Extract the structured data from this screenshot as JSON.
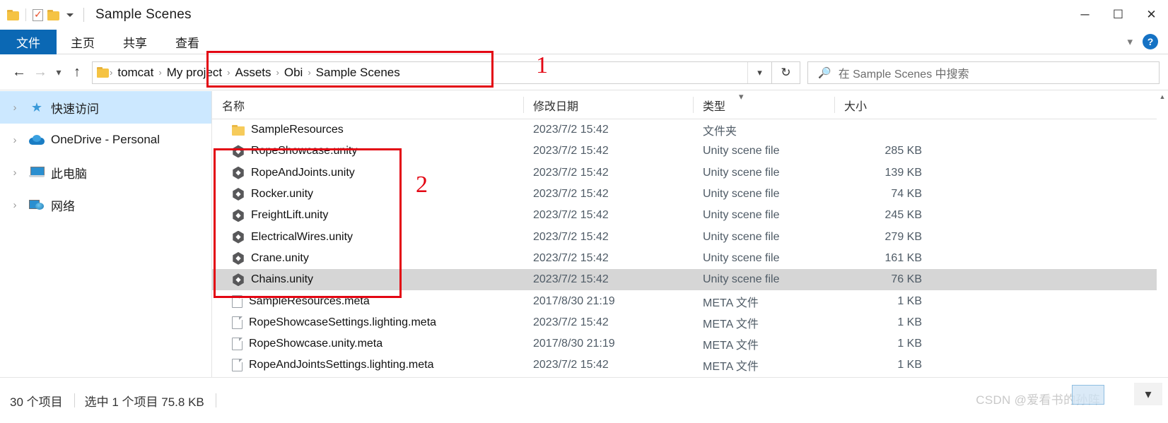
{
  "window": {
    "title": "Sample Scenes",
    "quick_access": {
      "folder_icon": "folder-icon",
      "properties_icon": "properties-checkbox-icon",
      "new_folder_icon": "new-folder-icon",
      "customize_caret": "chevron-down-icon"
    },
    "controls": {
      "minimize": "─",
      "maximize": "☐",
      "close": "✕"
    }
  },
  "ribbon": {
    "tabs": [
      {
        "label": "文件",
        "active": true
      },
      {
        "label": "主页",
        "active": false
      },
      {
        "label": "共享",
        "active": false
      },
      {
        "label": "查看",
        "active": false
      }
    ],
    "collapse_icon": "chevron-down-icon",
    "help_label": "?"
  },
  "address": {
    "back_icon": "arrow-left-icon",
    "forward_icon": "arrow-right-icon",
    "recent_icon": "chevron-down-icon",
    "up_icon": "arrow-up-icon",
    "folder_icon": "folder-icon",
    "crumbs": [
      {
        "label": "tomcat",
        "highlighted": false
      },
      {
        "label": "My project",
        "highlighted": true
      },
      {
        "label": "Assets",
        "highlighted": true
      },
      {
        "label": "Obi",
        "highlighted": true
      },
      {
        "label": "Sample Scenes",
        "highlighted": true
      }
    ],
    "separator": "›",
    "dropdown_icon": "chevron-down-icon",
    "refresh_icon": "↻"
  },
  "search": {
    "icon": "search-icon",
    "placeholder": "在 Sample Scenes 中搜索",
    "value": ""
  },
  "sidebar": {
    "items": [
      {
        "label": "快速访问",
        "icon": "star-pin-icon",
        "selected": true
      },
      {
        "label": "OneDrive - Personal",
        "icon": "onedrive-cloud-icon",
        "selected": false
      },
      {
        "label": "此电脑",
        "icon": "this-pc-icon",
        "selected": false
      },
      {
        "label": "网络",
        "icon": "network-icon",
        "selected": false
      }
    ],
    "expand_icon": "chevron-right-icon"
  },
  "filelist": {
    "columns": [
      {
        "key": "name",
        "label": "名称"
      },
      {
        "key": "date",
        "label": "修改日期"
      },
      {
        "key": "type",
        "label": "类型"
      },
      {
        "key": "size",
        "label": "大小"
      }
    ],
    "sort_indicator": "chevron-down-icon",
    "rows": [
      {
        "name": "SampleResources",
        "date": "2023/7/2 15:42",
        "type": "文件夹",
        "size": "",
        "icon": "folder-icon",
        "selected": false
      },
      {
        "name": "RopeShowcase.unity",
        "date": "2023/7/2 15:42",
        "type": "Unity scene file",
        "size": "285 KB",
        "icon": "unity-scene-icon",
        "selected": false
      },
      {
        "name": "RopeAndJoints.unity",
        "date": "2023/7/2 15:42",
        "type": "Unity scene file",
        "size": "139 KB",
        "icon": "unity-scene-icon",
        "selected": false
      },
      {
        "name": "Rocker.unity",
        "date": "2023/7/2 15:42",
        "type": "Unity scene file",
        "size": "74 KB",
        "icon": "unity-scene-icon",
        "selected": false
      },
      {
        "name": "FreightLift.unity",
        "date": "2023/7/2 15:42",
        "type": "Unity scene file",
        "size": "245 KB",
        "icon": "unity-scene-icon",
        "selected": false
      },
      {
        "name": "ElectricalWires.unity",
        "date": "2023/7/2 15:42",
        "type": "Unity scene file",
        "size": "279 KB",
        "icon": "unity-scene-icon",
        "selected": false
      },
      {
        "name": "Crane.unity",
        "date": "2023/7/2 15:42",
        "type": "Unity scene file",
        "size": "161 KB",
        "icon": "unity-scene-icon",
        "selected": false
      },
      {
        "name": "Chains.unity",
        "date": "2023/7/2 15:42",
        "type": "Unity scene file",
        "size": "76 KB",
        "icon": "unity-scene-icon",
        "selected": true
      },
      {
        "name": "SampleResources.meta",
        "date": "2017/8/30 21:19",
        "type": "META 文件",
        "size": "1 KB",
        "icon": "generic-file-icon",
        "selected": false
      },
      {
        "name": "RopeShowcaseSettings.lighting.meta",
        "date": "2023/7/2 15:42",
        "type": "META 文件",
        "size": "1 KB",
        "icon": "generic-file-icon",
        "selected": false
      },
      {
        "name": "RopeShowcase.unity.meta",
        "date": "2017/8/30 21:19",
        "type": "META 文件",
        "size": "1 KB",
        "icon": "generic-file-icon",
        "selected": false
      },
      {
        "name": "RopeAndJointsSettings.lighting.meta",
        "date": "2023/7/2 15:42",
        "type": "META 文件",
        "size": "1 KB",
        "icon": "generic-file-icon",
        "selected": false
      }
    ]
  },
  "statusbar": {
    "item_count": "30 个项目",
    "selection": "选中 1 个项目  75.8 KB"
  },
  "annotations": [
    {
      "id": "1",
      "label": "1",
      "target": "breadcrumb-path"
    },
    {
      "id": "2",
      "label": "2",
      "target": "unity-scene-files"
    }
  ],
  "watermark": {
    "text": "CSDN @爱看书的孙阵"
  },
  "colors": {
    "accent": "#0b68b4",
    "selection": "#cce8ff",
    "row_selection": "#d6d6d6",
    "annotation_red": "#e30613",
    "folder_yellow": "#f6cb5b"
  }
}
